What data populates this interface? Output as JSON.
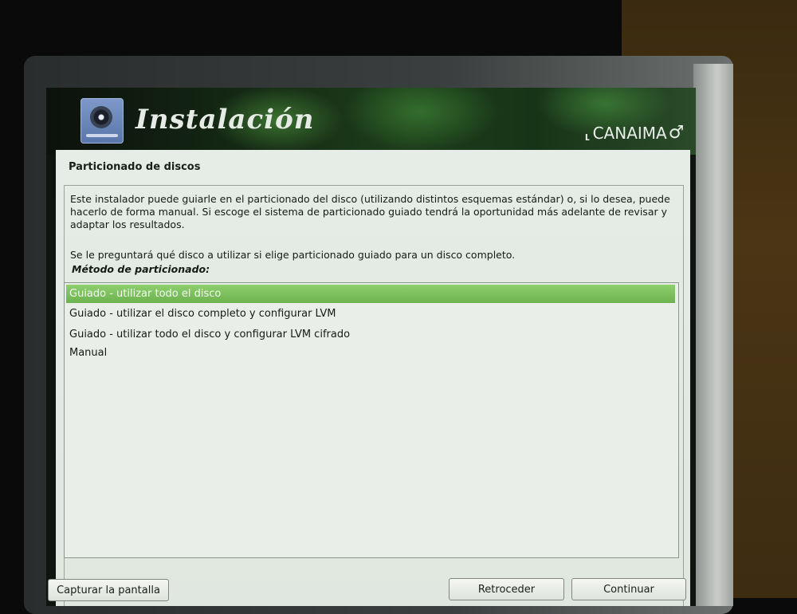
{
  "header": {
    "title": "Instalación",
    "brand": "CANAIMA",
    "logo_icon": "disc-drive-icon"
  },
  "section": {
    "title": "Particionado de discos",
    "description": "Este instalador puede guiarle en el particionado del disco (utilizando distintos esquemas estándar) o, si lo desea, puede hacerlo de forma manual. Si escoge el sistema de particionado guiado tendrá la oportunidad más adelante de revisar y adaptar los resultados.",
    "question": "Se le preguntará qué disco a utilizar si elige particionado guiado para un disco completo.",
    "method_label": "Método de particionado:"
  },
  "options": [
    {
      "label": "Guiado - utilizar todo el disco",
      "selected": true
    },
    {
      "label": "Guiado - utilizar el disco completo y configurar LVM",
      "selected": false
    },
    {
      "label": "Guiado - utilizar todo el disco y configurar LVM cifrado",
      "selected": false
    },
    {
      "label": "Manual",
      "selected": false
    }
  ],
  "buttons": {
    "screenshot": "Capturar la pantalla",
    "back": "Retroceder",
    "continue": "Continuar"
  },
  "colors": {
    "selection": "#7cc05c",
    "panel": "#e4ebe4"
  }
}
